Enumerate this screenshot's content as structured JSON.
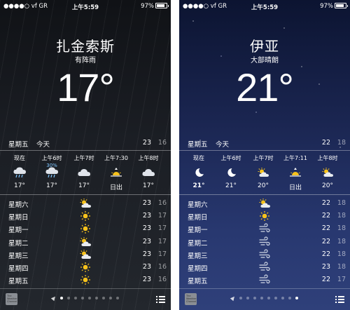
{
  "phones": [
    {
      "status": {
        "carrier": "●●●●○ vf GR",
        "time": "上午5:59",
        "battery": "97%"
      },
      "city": "扎金索斯",
      "condition": "有阵雨",
      "temp": "17°",
      "today": {
        "day": "星期五",
        "label": "今天",
        "hi": "23",
        "lo": "16"
      },
      "hourly": [
        {
          "time": "现在",
          "precip": "",
          "icon": "rain-cloud-icon",
          "value": "17°"
        },
        {
          "time": "上午6时",
          "precip": "30%",
          "icon": "rain-cloud-icon",
          "value": "17°"
        },
        {
          "time": "上午7时",
          "precip": "",
          "icon": "cloud-icon",
          "value": "17°"
        },
        {
          "time": "上午7:30",
          "precip": "",
          "icon": "sunrise-icon",
          "value": "日出"
        },
        {
          "time": "上午8时",
          "precip": "",
          "icon": "cloud-icon",
          "value": "17°"
        }
      ],
      "daily": [
        {
          "day": "星期六",
          "icon": "partly-sunny-icon",
          "hi": "23",
          "lo": "16"
        },
        {
          "day": "星期日",
          "icon": "sun-icon",
          "hi": "23",
          "lo": "17"
        },
        {
          "day": "星期一",
          "icon": "sun-icon",
          "hi": "23",
          "lo": "17"
        },
        {
          "day": "星期二",
          "icon": "partly-sunny-icon",
          "hi": "23",
          "lo": "17"
        },
        {
          "day": "星期三",
          "icon": "partly-sunny-icon",
          "hi": "23",
          "lo": "17"
        },
        {
          "day": "星期四",
          "icon": "sun-icon",
          "hi": "23",
          "lo": "16"
        },
        {
          "day": "星期五",
          "icon": "sun-icon",
          "hi": "23",
          "lo": "16"
        }
      ],
      "logo_text": "The Weather Channel",
      "page_index": 1
    },
    {
      "status": {
        "carrier": "●●●●○ vf GR",
        "time": "上午5:59",
        "battery": "97%"
      },
      "city": "伊亚",
      "condition": "大部晴朗",
      "temp": "21°",
      "today": {
        "day": "星期五",
        "label": "今天",
        "hi": "22",
        "lo": "18"
      },
      "hourly": [
        {
          "time": "现在",
          "precip": "",
          "icon": "moon-icon",
          "value": "21°",
          "bold": true
        },
        {
          "time": "上午6时",
          "precip": "",
          "icon": "moon-icon",
          "value": "21°"
        },
        {
          "time": "上午7时",
          "precip": "",
          "icon": "partly-sunny-icon",
          "value": "20°"
        },
        {
          "time": "上午7:11",
          "precip": "",
          "icon": "sunrise-icon",
          "value": "日出"
        },
        {
          "time": "上午8时",
          "precip": "",
          "icon": "partly-sunny-icon",
          "value": "20°"
        }
      ],
      "daily": [
        {
          "day": "星期六",
          "icon": "partly-sunny-icon",
          "hi": "22",
          "lo": "18"
        },
        {
          "day": "星期日",
          "icon": "sun-icon",
          "hi": "22",
          "lo": "18"
        },
        {
          "day": "星期一",
          "icon": "wind-icon",
          "hi": "22",
          "lo": "18"
        },
        {
          "day": "星期二",
          "icon": "wind-icon",
          "hi": "22",
          "lo": "18"
        },
        {
          "day": "星期三",
          "icon": "wind-icon",
          "hi": "22",
          "lo": "18"
        },
        {
          "day": "星期四",
          "icon": "wind-icon",
          "hi": "23",
          "lo": "18"
        },
        {
          "day": "星期五",
          "icon": "wind-icon",
          "hi": "22",
          "lo": "17"
        }
      ],
      "logo_text": "The Weather Channel",
      "page_index": 9
    }
  ],
  "page_count": 10,
  "colors": {
    "sun": "#f6c21c",
    "precip": "#7fc6ff"
  }
}
